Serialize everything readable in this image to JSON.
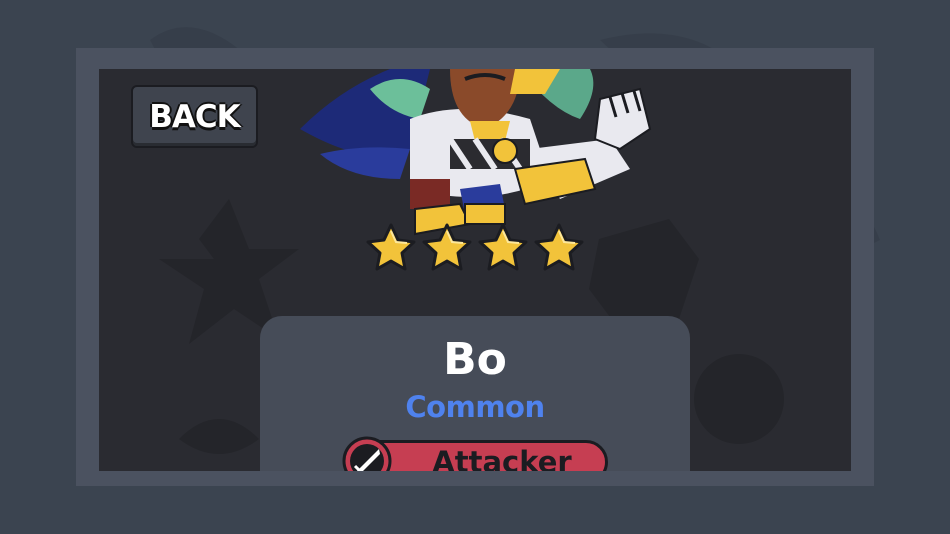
{
  "back_button": {
    "label": "BACK"
  },
  "hero": {
    "name": "Bo",
    "rarity": "Common",
    "class": "Attacker",
    "stars": 4
  },
  "colors": {
    "rarity": "#4f82ee",
    "class_pill": "#c63e52",
    "star": "#f2c33a"
  },
  "icons": {
    "class_icon": "sword-icon",
    "star_icon": "star-icon"
  }
}
